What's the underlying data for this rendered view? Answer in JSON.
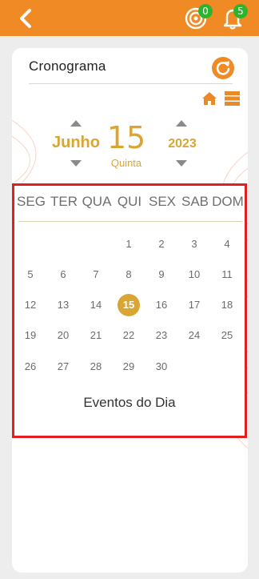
{
  "header": {
    "target_badge": "0",
    "bell_badge": "5",
    "icons": [
      "back-arrow-icon",
      "target-icon",
      "bell-icon"
    ]
  },
  "page": {
    "title": "Cronograma"
  },
  "date_picker": {
    "month": "Junho",
    "day": "15",
    "weekday": "Quinta",
    "year": "2023"
  },
  "calendar": {
    "weekdays": [
      "SEG",
      "TER",
      "QUA",
      "QUI",
      "SEX",
      "SAB",
      "DOM"
    ],
    "weeks": [
      [
        "",
        "",
        "",
        "1",
        "2",
        "3",
        "4"
      ],
      [
        "5",
        "6",
        "7",
        "8",
        "9",
        "10",
        "11"
      ],
      [
        "12",
        "13",
        "14",
        "15",
        "16",
        "17",
        "18"
      ],
      [
        "19",
        "20",
        "21",
        "22",
        "23",
        "24",
        "25"
      ],
      [
        "26",
        "27",
        "28",
        "29",
        "30",
        "",
        ""
      ]
    ],
    "selected_day": "15",
    "events_title": "Eventos do Dia"
  },
  "colors": {
    "accent_orange": "#f08a24",
    "gold": "#d9a634",
    "highlight_red": "#e21f1f",
    "badge_green": "#2fb32f"
  }
}
